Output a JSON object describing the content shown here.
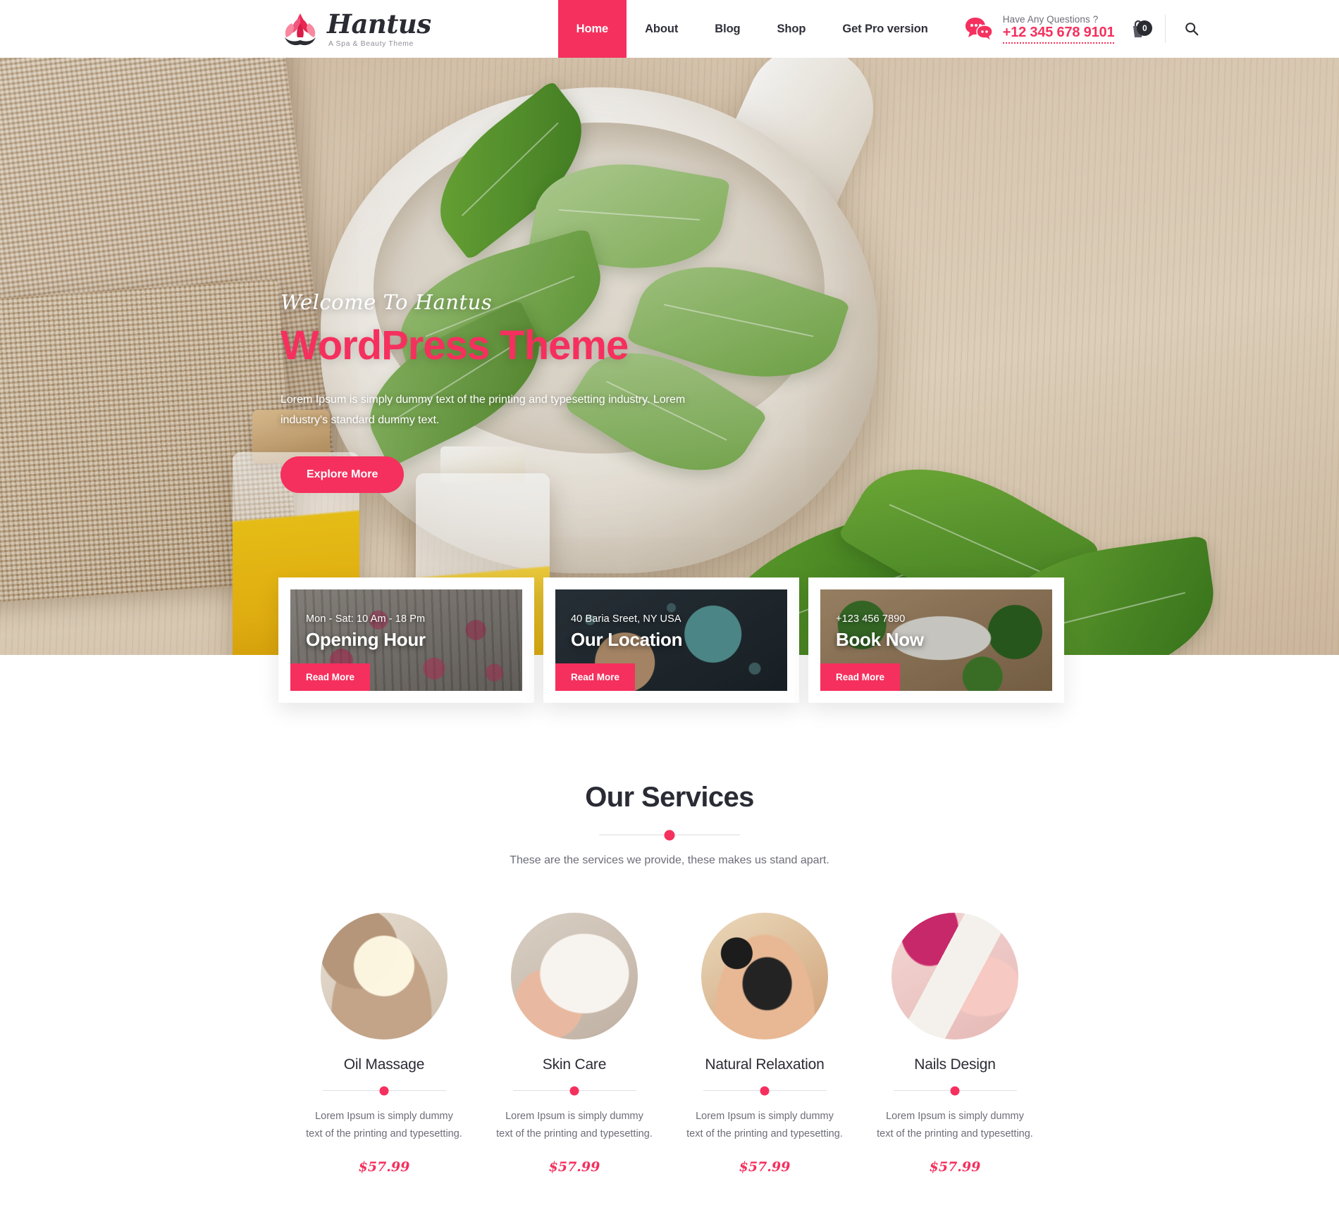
{
  "brand": {
    "name": "Hantus",
    "tagline": "A Spa & Beauty Theme",
    "logo_icon": "lotus-flower-icon",
    "accent_color": "#F5305E",
    "dark_color": "#2B2B36"
  },
  "nav": {
    "items": [
      {
        "label": "Home",
        "active": true
      },
      {
        "label": "About",
        "active": false
      },
      {
        "label": "Blog",
        "active": false
      },
      {
        "label": "Shop",
        "active": false
      },
      {
        "label": "Get Pro version",
        "active": false
      }
    ]
  },
  "header_right": {
    "chat_icon": "chat-bubbles-icon",
    "questions_label": "Have Any Questions ?",
    "phone": "+12 345 678 9101",
    "cart_icon": "shopping-cart-icon",
    "cart_count": "0",
    "search_icon": "search-icon"
  },
  "hero": {
    "welcome": "Welcome To Hantus",
    "title": "WordPress Theme",
    "description": "Lorem Ipsum is simply dummy text of the printing and typesetting industry. Lorem industry's standard dummy text.",
    "cta_label": "Explore More"
  },
  "info_cards": [
    {
      "subtitle": "Mon - Sat: 10 Am - 18 Pm",
      "title": "Opening Hour",
      "button": "Read More",
      "media": "media-1"
    },
    {
      "subtitle": "40 Baria Sreet, NY USA",
      "title": "Our Location",
      "button": "Read More",
      "media": "media-2"
    },
    {
      "subtitle": "+123 456 7890",
      "title": "Book Now",
      "button": "Read More",
      "media": "media-3"
    }
  ],
  "services": {
    "heading": "Our Services",
    "subheading": "These are the services we provide, these makes us stand apart.",
    "items": [
      {
        "name": "Oil Massage",
        "description": "Lorem Ipsum is simply dummy text of the printing and typesetting.",
        "price": "$57.99",
        "image": "svc-img-1"
      },
      {
        "name": "Skin Care",
        "description": "Lorem Ipsum is simply dummy text of the printing and typesetting.",
        "price": "$57.99",
        "image": "svc-img-2"
      },
      {
        "name": "Natural Relaxation",
        "description": "Lorem Ipsum is simply dummy text of the printing and typesetting.",
        "price": "$57.99",
        "image": "svc-img-3"
      },
      {
        "name": "Nails Design",
        "description": "Lorem Ipsum is simply dummy text of the printing and typesetting.",
        "price": "$57.99",
        "image": "svc-img-4"
      }
    ]
  }
}
